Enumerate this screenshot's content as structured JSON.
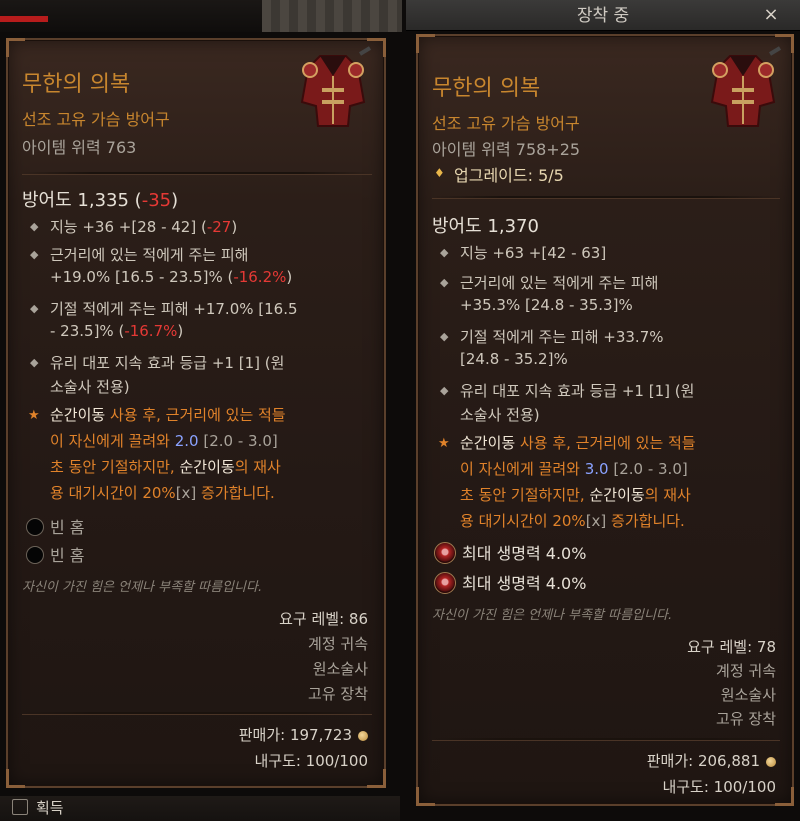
{
  "header": {
    "equipped_label": "장착 중",
    "close_icon": "×"
  },
  "left_item": {
    "name": "무한의 의복",
    "type_line": "선조 고유 가슴 방어구",
    "item_power": "아이템 위력 763",
    "armor_label": "방어도 1,335",
    "armor_diff_open": "(",
    "armor_diff": "-35",
    "armor_diff_close": ")",
    "stats": {
      "s1_text": "지능 +36 +[28 - 42] (",
      "s1_diff": "-27",
      "s1_close": ")",
      "s2_line1": "근거리에 있는 적에게 주는 피해",
      "s2_line2": "+19.0% [16.5 - 23.5]% (",
      "s2_diff": "-16.2%",
      "s2_close": ")",
      "s3_line1": "기절 적에게 주는 피해 +17.0% [16.5",
      "s3_line2": "- 23.5]% (",
      "s3_diff": "-16.7%",
      "s3_close": ")",
      "s4_line1": "유리 대포 지속 효과 등급 +1 [1] (원",
      "s4_line2": "소술사 전용)"
    },
    "unique": {
      "l1_a": "순간이동",
      "l1_b": " 사용 후, 근거리에 있는 적들",
      "l2": "이 자신에게 끌려와 ",
      "l2_val": "2.0",
      "l2_range": " [2.0 - 3.0]",
      "l3_a": "초 동안 기절하지만, ",
      "l3_b": "순간이동",
      "l3_c": "의 재사",
      "l4_a": "용 대기시간이 20%",
      "l4_x": "[x]",
      "l4_b": " 증가합니다."
    },
    "sockets": [
      "빈 홈",
      "빈 홈"
    ],
    "flavor": "자신이 가진 힘은 언제나 부족할 따름입니다.",
    "requirements": {
      "level": "요구 레벨: 86",
      "bind": "계정 귀속",
      "class": "원소술사",
      "equip": "고유 장착"
    },
    "sell_value": "판매가: 197,723",
    "durability": "내구도: 100/100"
  },
  "right_item": {
    "name": "무한의 의복",
    "type_line": "선조 고유 가슴 방어구",
    "item_power": "아이템 위력 758+25",
    "upgrade": "업그레이드: 5/5",
    "armor_label": "방어도 1,370",
    "stats": {
      "s1": "지능 +63 +[42 - 63]",
      "s2_line1": "근거리에 있는 적에게 주는 피해",
      "s2_line2": "+35.3% [24.8 - 35.3]%",
      "s3_line1": "기절 적에게 주는 피해 +33.7%",
      "s3_line2": "[24.8 - 35.2]%",
      "s4_line1": "유리 대포 지속 효과 등급 +1 [1] (원",
      "s4_line2": "소술사 전용)"
    },
    "unique": {
      "l1_a": "순간이동",
      "l1_b": " 사용 후, 근거리에 있는 적들",
      "l2": "이 자신에게 끌려와 ",
      "l2_val": "3.0",
      "l2_range": " [2.0 - 3.0]",
      "l3_a": "초 동안 기절하지만, ",
      "l3_b": "순간이동",
      "l3_c": "의 재사",
      "l4_a": "용 대기시간이 20%",
      "l4_x": "[x]",
      "l4_b": " 증가합니다."
    },
    "gems": [
      "최대 생명력 4.0%",
      "최대 생명력 4.0%"
    ],
    "flavor": "자신이 가진 힘은 언제나 부족할 따름입니다.",
    "requirements": {
      "level": "요구 레벨: 78",
      "bind": "계정 귀속",
      "class": "원소술사",
      "equip": "고유 장착"
    },
    "sell_value": "판매가: 206,881",
    "durability": "내구도: 100/100"
  },
  "footer": {
    "acquire_label": "획득"
  },
  "colors": {
    "legendary": "#c8862e",
    "negative": "#e53935",
    "highlight": "#8aa2ff",
    "unique": "#e0822a"
  },
  "icons": {
    "armor": "chest-armor-icon",
    "bullet": "diamond-bullet-icon",
    "unique": "star-icon",
    "socket": "empty-socket-icon",
    "gem": "ruby-gem-icon",
    "gold": "gold-coin-icon"
  }
}
